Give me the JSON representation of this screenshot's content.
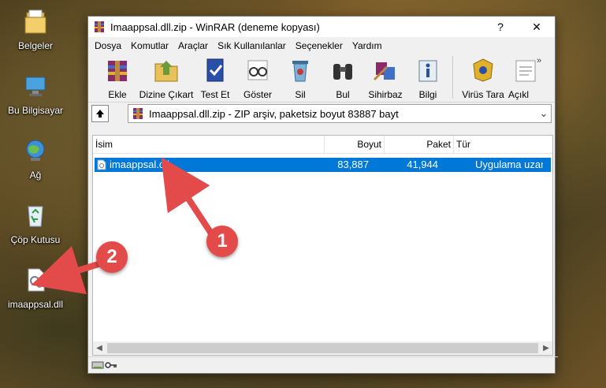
{
  "desktop": {
    "icons": [
      {
        "label": "Belgeler"
      },
      {
        "label": "Bu Bilgisayar"
      },
      {
        "label": "Ağ"
      },
      {
        "label": "Çöp Kutusu"
      },
      {
        "label": "imaappsal.dll"
      }
    ]
  },
  "window": {
    "title": "Imaappsal.dll.zip - WinRAR (deneme kopyası)",
    "help_button": "?",
    "close_button": "✕",
    "menu": [
      "Dosya",
      "Komutlar",
      "Araçlar",
      "Sık Kullanılanlar",
      "Seçenekler",
      "Yardım"
    ],
    "toolbar": [
      "Ekle",
      "Dizine Çıkart",
      "Test Et",
      "Göster",
      "Sil",
      "Bul",
      "Sihirbaz",
      "Bilgi",
      "Virüs Tara",
      "Açıkl"
    ],
    "overflow": "»",
    "address": "Imaappsal.dll.zip - ZIP arşiv, paketsiz boyut 83887 bayt",
    "columns": [
      "İsim",
      "Boyut",
      "Paket",
      "Tür"
    ],
    "files": [
      {
        "name": "imaappsal.dll",
        "size": "83,887",
        "packed": "41,944",
        "type": "Uygulama uzantısı"
      }
    ]
  },
  "callouts": [
    "1",
    "2"
  ],
  "colors": {
    "selection": "#0078d7",
    "callout": "#e34a4a"
  }
}
